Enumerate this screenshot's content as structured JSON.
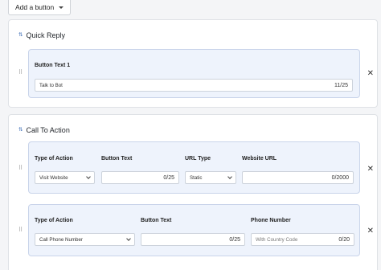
{
  "toolbar": {
    "add_button_label": "Add a button"
  },
  "quick_reply": {
    "title": "Quick Reply",
    "button_text_label": "Button Text 1",
    "button_text_value": "Talk to Bot",
    "button_text_count": "11/25"
  },
  "call_to_action": {
    "title": "Call To Action",
    "website_card": {
      "type_label": "Type of Action",
      "type_value": "Visit Website",
      "button_text_label": "Button Text",
      "button_text_count": "0/25",
      "url_type_label": "URL Type",
      "url_type_value": "Static",
      "website_url_label": "Website URL",
      "website_url_count": "0/2000"
    },
    "phone_card": {
      "type_label": "Type of Action",
      "type_value": "Call Phone Number",
      "button_text_label": "Button Text",
      "button_text_count": "0/25",
      "phone_label": "Phone Number",
      "phone_placeholder": "With Country Code",
      "phone_count": "0/20"
    }
  },
  "icons": {
    "drag": "drag-handle-icon",
    "remove": "close-icon",
    "section": "sort-icon"
  }
}
